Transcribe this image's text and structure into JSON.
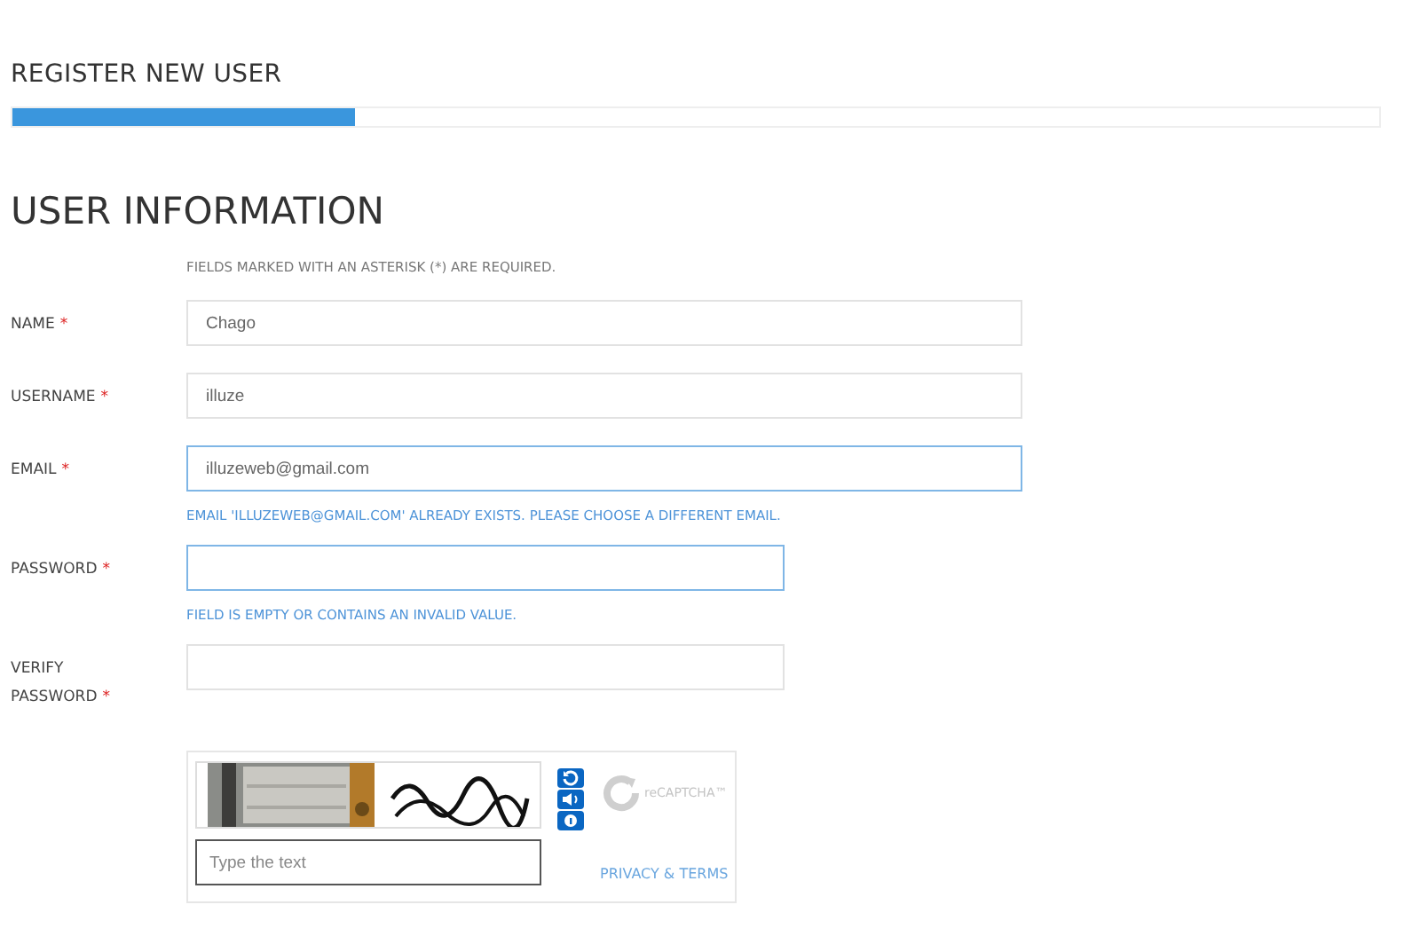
{
  "page_title": "REGISTER NEW USER",
  "progress": {
    "level": 0.25
  },
  "section_title": "USER INFORMATION",
  "required_note": "FIELDS MARKED WITH AN ASTERISK (*) ARE REQUIRED.",
  "fields": [
    {
      "label": "NAME",
      "required_mark": "*",
      "value": "Chago",
      "kind": "wide",
      "highlighted": false
    },
    {
      "label": "USERNAME",
      "required_mark": "*",
      "value": "illuze",
      "kind": "wide",
      "highlighted": false
    },
    {
      "label": "EMAIL",
      "required_mark": "*",
      "value": "illuzeweb@gmail.com",
      "kind": "wide",
      "highlighted": true,
      "error": "EMAIL 'ILLUZEWEB@GMAIL.COM' ALREADY EXISTS. PLEASE CHOOSE A DIFFERENT EMAIL."
    },
    {
      "label": "PASSWORD",
      "required_mark": "*",
      "kind": "narrow",
      "highlighted": true,
      "error": "FIELD IS EMPTY OR CONTAINS AN INVALID VALUE."
    },
    {
      "label": "VERIFY PASSWORD",
      "required_mark": "*",
      "kind": "narrow",
      "highlighted": false
    }
  ],
  "captcha": {
    "answer_placeholder": "Type the text",
    "logo_text": "reCAPTCHA™",
    "link": "PRIVACY & TERMS"
  }
}
